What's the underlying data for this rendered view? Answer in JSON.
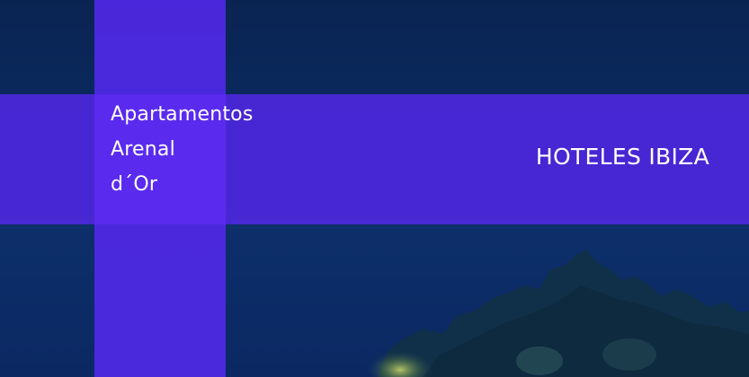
{
  "hotel_name_lines": [
    "Apartamentos",
    "Arenal",
    "d´Or"
  ],
  "section_title": "HOTELES IBIZA",
  "colors": {
    "night_sky": "#0b2a60",
    "overlay_purple": "#4a28d7",
    "intersection_purple": "#5a2bef",
    "text": "#ffffff"
  }
}
